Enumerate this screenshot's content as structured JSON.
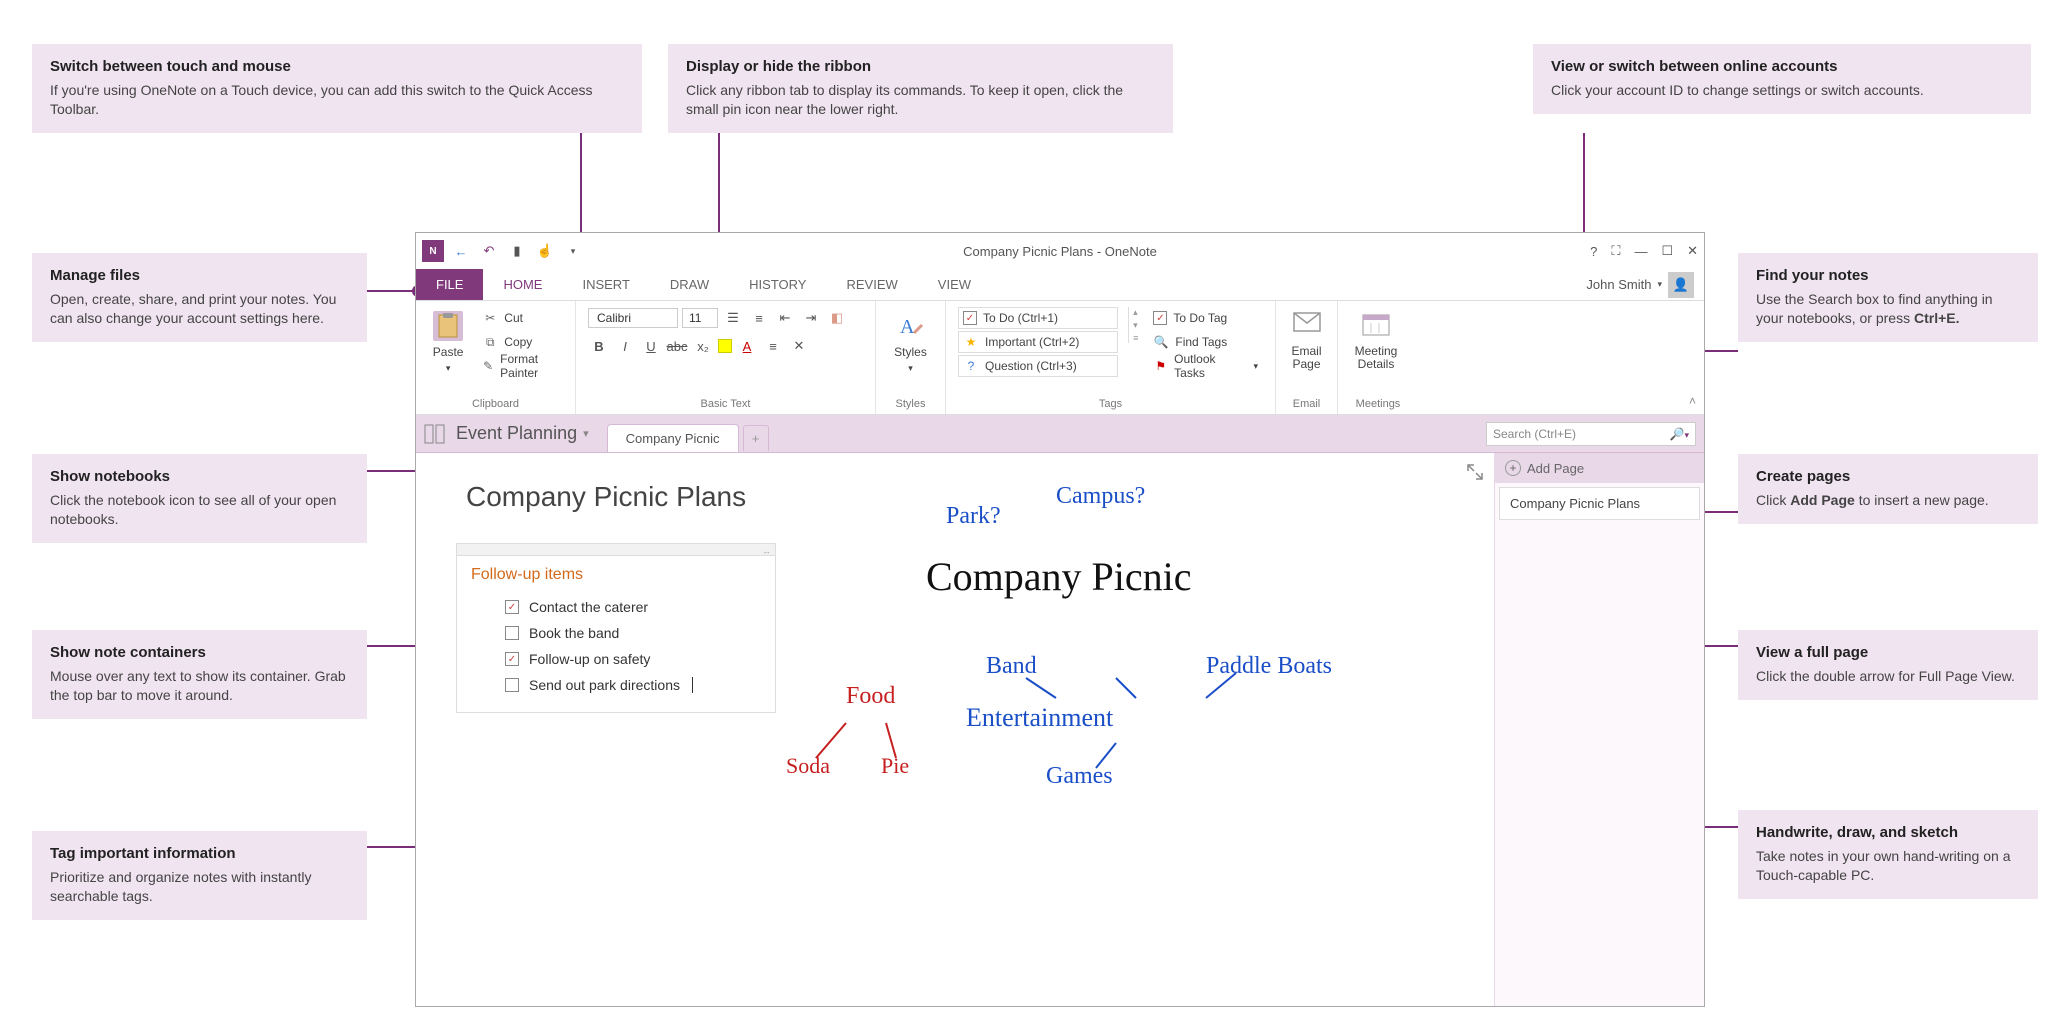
{
  "callouts": {
    "touch_switch": {
      "title": "Switch between touch and mouse",
      "body": "If you're using OneNote on a Touch device, you can add this switch to the Quick Access Toolbar."
    },
    "ribbon_toggle": {
      "title": "Display or hide the ribbon",
      "body": "Click any ribbon tab to display its commands. To keep it open, click the small pin icon near the lower right."
    },
    "accounts": {
      "title": "View or switch between online accounts",
      "body": "Click your account ID to change settings or switch accounts."
    },
    "manage_files": {
      "title": "Manage files",
      "body": "Open, create, share, and print your notes. You can also change your account settings here."
    },
    "show_notebooks": {
      "title": "Show notebooks",
      "body": "Click the notebook icon to see all of your open notebooks."
    },
    "note_containers": {
      "title": "Show note containers",
      "body": "Mouse over any text to show its container. Grab the top bar to move it around."
    },
    "tag_info": {
      "title": "Tag important information",
      "body": "Prioritize and organize notes with instantly searchable tags."
    },
    "find_notes": {
      "title": "Find your notes",
      "body_a": "Use the Search box to find anything in your notebooks, or press ",
      "body_b": "Ctrl+E."
    },
    "create_pages": {
      "title": "Create pages",
      "body_a": "Click ",
      "body_bold": "Add Page",
      "body_b": " to insert a new page."
    },
    "full_page": {
      "title": "View a full page",
      "body": "Click the double arrow for Full Page View."
    },
    "handwrite": {
      "title": "Handwrite, draw, and sketch",
      "body": "Take notes in your own hand-writing on a Touch-capable PC."
    }
  },
  "window_title": "Company Picnic Plans - OneNote",
  "account_name": "John Smith",
  "tabs": {
    "file": "FILE",
    "home": "HOME",
    "insert": "INSERT",
    "draw": "DRAW",
    "history": "HISTORY",
    "review": "REVIEW",
    "view": "VIEW"
  },
  "ribbon": {
    "clipboard": {
      "paste": "Paste",
      "cut": "Cut",
      "copy": "Copy",
      "format_painter": "Format Painter",
      "label": "Clipboard"
    },
    "basic_text": {
      "font": "Calibri",
      "size": "11",
      "label": "Basic Text"
    },
    "styles": {
      "btn": "Styles",
      "label": "Styles"
    },
    "tags": {
      "todo": "To Do (Ctrl+1)",
      "important": "Important (Ctrl+2)",
      "question": "Question (Ctrl+3)",
      "todo_tag": "To Do Tag",
      "find_tags": "Find Tags",
      "outlook": "Outlook Tasks",
      "label": "Tags"
    },
    "email": {
      "btn": "Email Page",
      "label": "Email"
    },
    "meetings": {
      "btn": "Meeting Details",
      "label": "Meetings"
    }
  },
  "notebook": {
    "name": "Event Planning",
    "section": "Company Picnic",
    "search_placeholder": "Search (Ctrl+E)"
  },
  "page": {
    "title": "Company Picnic Plans",
    "container_title": "Follow-up items",
    "items": [
      {
        "text": "Contact the caterer",
        "checked": true
      },
      {
        "text": "Book the band",
        "checked": false
      },
      {
        "text": "Follow-up on safety",
        "checked": true
      },
      {
        "text": "Send out park directions",
        "checked": false
      }
    ],
    "add_page": "Add Page",
    "page_list_item": "Company Picnic Plans"
  },
  "handwriting": {
    "park": "Park?",
    "campus": "Campus?",
    "title": "Company Picnic",
    "band": "Band",
    "entertainment": "Entertainment",
    "games": "Games",
    "paddle": "Paddle Boats",
    "food": "Food",
    "soda": "Soda",
    "pie": "Pie"
  }
}
